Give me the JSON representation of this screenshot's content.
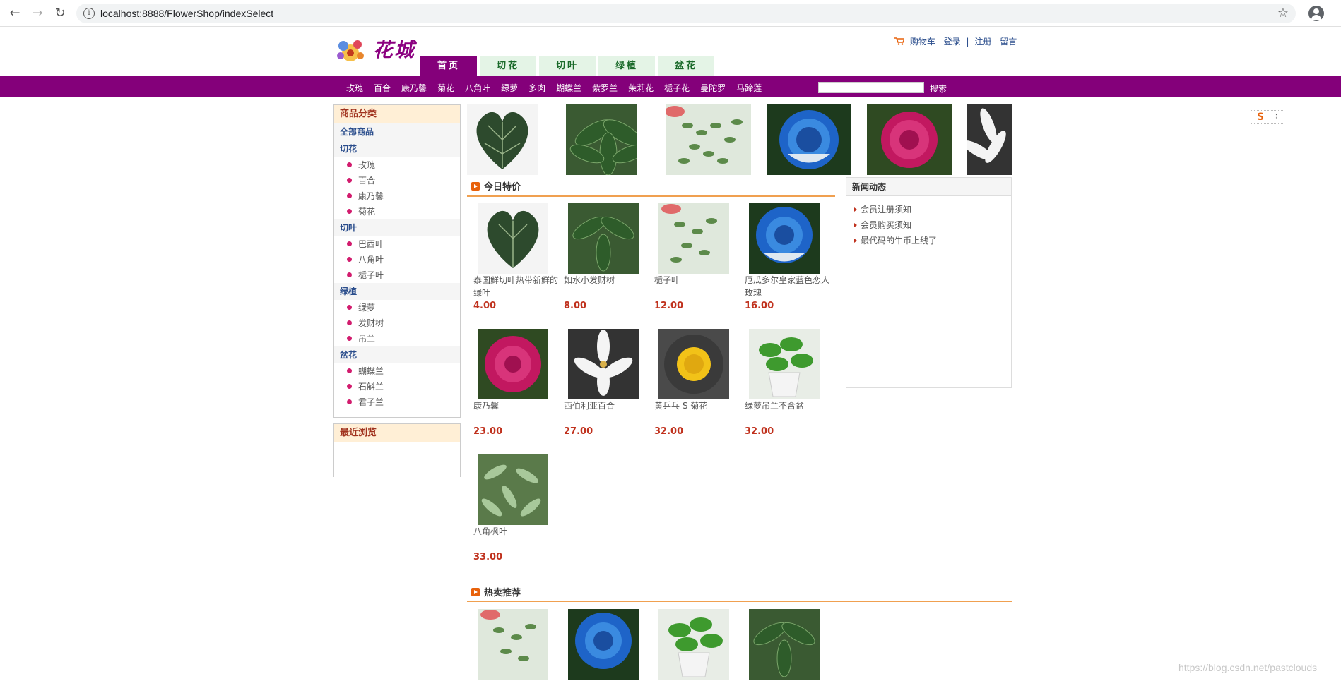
{
  "browser": {
    "url": "localhost:8888/FlowerShop/indexSelect"
  },
  "header": {
    "logo_text": "花城",
    "links": {
      "cart": "购物车",
      "login": "登录",
      "sep": "|",
      "register": "注册",
      "message": "留言"
    },
    "tabs": [
      "首页",
      "切花",
      "切叶",
      "绿植",
      "盆花"
    ]
  },
  "catbar": {
    "items": [
      "玫瑰",
      "百合",
      "康乃馨",
      "菊花",
      "八角叶",
      "绿萝",
      "多肉",
      "蝴蝶兰",
      "紫罗兰",
      "茉莉花",
      "栀子花",
      "曼陀罗",
      "马蹄莲"
    ],
    "search_button": "搜索"
  },
  "sidebar": {
    "title": "商品分类",
    "all": "全部商品",
    "groups": [
      {
        "name": "切花",
        "items": [
          "玫瑰",
          "百合",
          "康乃馨",
          "菊花"
        ]
      },
      {
        "name": "切叶",
        "items": [
          "巴西叶",
          "八角叶",
          "栀子叶"
        ]
      },
      {
        "name": "绿植",
        "items": [
          "绿萝",
          "发财树",
          "吊兰"
        ]
      },
      {
        "name": "盆花",
        "items": [
          "蝴蝶兰",
          "石斛兰",
          "君子兰"
        ]
      }
    ],
    "recent_title": "最近浏览"
  },
  "today": {
    "title": "今日特价",
    "products": [
      {
        "name": "泰国鲜切叶热带新鲜的绿叶",
        "price": "4.00"
      },
      {
        "name": "如水小发财树",
        "price": "8.00"
      },
      {
        "name": "栀子叶",
        "price": "12.00"
      },
      {
        "name": "厄瓜多尔皇家蓝色恋人玫瑰",
        "price": "16.00"
      },
      {
        "name": "康乃馨",
        "price": "23.00"
      },
      {
        "name": "西伯利亚百合",
        "price": "27.00"
      },
      {
        "name": "黄乒乓 S 菊花",
        "price": "32.00"
      },
      {
        "name": "绿萝吊兰不含盆",
        "price": "32.00"
      },
      {
        "name": "八角枫叶",
        "price": "33.00"
      }
    ]
  },
  "news": {
    "title": "新闻动态",
    "items": [
      "会员注册须知",
      "会员购买须知",
      "最代码的牛币上线了"
    ]
  },
  "hot": {
    "title": "热卖推荐"
  },
  "watermark": "https://blog.csdn.net/pastclouds",
  "colors": {
    "brand": "#84007a",
    "price": "#c0321e",
    "accent": "#e8620c"
  }
}
